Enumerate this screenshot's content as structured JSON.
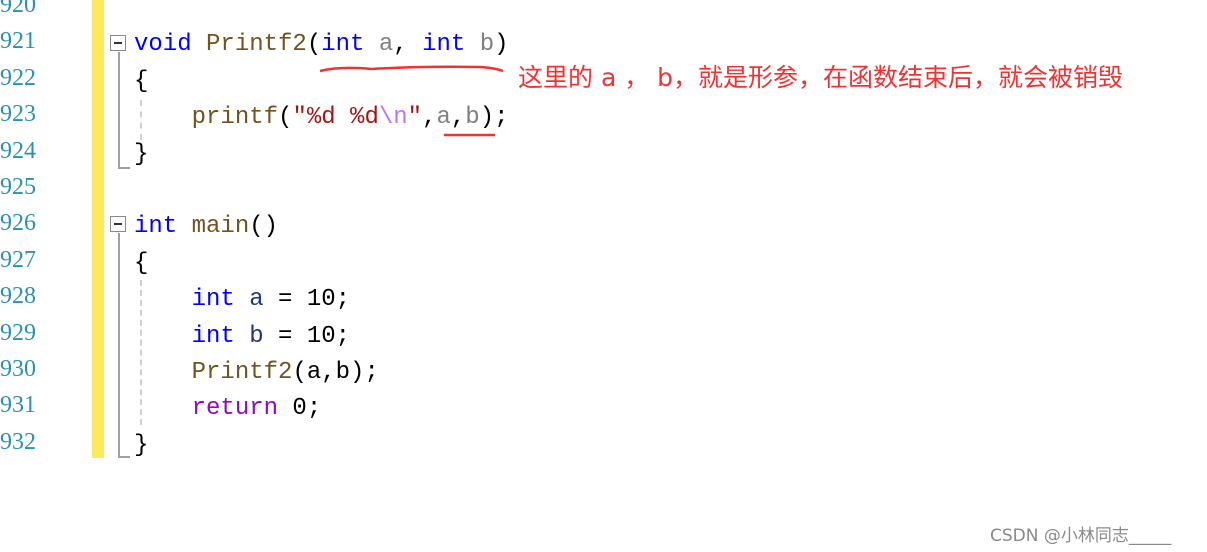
{
  "editor": {
    "line_numbers": [
      "920",
      "921",
      "922",
      "923",
      "924",
      "925",
      "926",
      "927",
      "928",
      "929",
      "930",
      "931",
      "932"
    ],
    "lines": [
      {
        "number": "921",
        "tokens": [
          {
            "t": "void",
            "c": "kw"
          },
          {
            "t": " ",
            "c": "plain"
          },
          {
            "t": "Printf2",
            "c": "fn"
          },
          {
            "t": "(",
            "c": "plain"
          },
          {
            "t": "int",
            "c": "kw"
          },
          {
            "t": " ",
            "c": "plain"
          },
          {
            "t": "a",
            "c": "param"
          },
          {
            "t": ", ",
            "c": "plain"
          },
          {
            "t": "int",
            "c": "kw"
          },
          {
            "t": " ",
            "c": "plain"
          },
          {
            "t": "b",
            "c": "param"
          },
          {
            "t": ")",
            "c": "plain"
          }
        ]
      },
      {
        "number": "922",
        "tokens": [
          {
            "t": "{",
            "c": "plain"
          }
        ]
      },
      {
        "number": "923",
        "tokens": [
          {
            "t": "    ",
            "c": "plain"
          },
          {
            "t": "printf",
            "c": "fn"
          },
          {
            "t": "(",
            "c": "plain"
          },
          {
            "t": "\"%d %d",
            "c": "str"
          },
          {
            "t": "\\n",
            "c": "esc"
          },
          {
            "t": "\"",
            "c": "str"
          },
          {
            "t": ",",
            "c": "plain"
          },
          {
            "t": "a",
            "c": "param"
          },
          {
            "t": ",",
            "c": "plain"
          },
          {
            "t": "b",
            "c": "param"
          },
          {
            "t": ");",
            "c": "plain"
          }
        ]
      },
      {
        "number": "924",
        "tokens": [
          {
            "t": "}",
            "c": "plain"
          }
        ]
      },
      {
        "number": "925",
        "tokens": []
      },
      {
        "number": "926",
        "tokens": [
          {
            "t": "int",
            "c": "kw"
          },
          {
            "t": " ",
            "c": "plain"
          },
          {
            "t": "main",
            "c": "fn"
          },
          {
            "t": "()",
            "c": "plain"
          }
        ]
      },
      {
        "number": "927",
        "tokens": [
          {
            "t": "{",
            "c": "plain"
          }
        ]
      },
      {
        "number": "928",
        "tokens": [
          {
            "t": "    ",
            "c": "plain"
          },
          {
            "t": "int",
            "c": "kw"
          },
          {
            "t": " ",
            "c": "plain"
          },
          {
            "t": "a",
            "c": "local"
          },
          {
            "t": " = 10;",
            "c": "plain"
          }
        ]
      },
      {
        "number": "929",
        "tokens": [
          {
            "t": "    ",
            "c": "plain"
          },
          {
            "t": "int",
            "c": "kw"
          },
          {
            "t": " ",
            "c": "plain"
          },
          {
            "t": "b",
            "c": "local"
          },
          {
            "t": " = 10;",
            "c": "plain"
          }
        ]
      },
      {
        "number": "930",
        "tokens": [
          {
            "t": "    ",
            "c": "plain"
          },
          {
            "t": "Printf2",
            "c": "fn"
          },
          {
            "t": "(a,b);",
            "c": "plain"
          }
        ]
      },
      {
        "number": "931",
        "tokens": [
          {
            "t": "    ",
            "c": "plain"
          },
          {
            "t": "return",
            "c": "ctl"
          },
          {
            "t": " 0;",
            "c": "plain"
          }
        ]
      },
      {
        "number": "932",
        "tokens": [
          {
            "t": "}",
            "c": "plain"
          }
        ]
      }
    ]
  },
  "annotation": {
    "text": "这里的 a ， b，就是形参，在函数结束后，就会被销毁",
    "color": "#f03232"
  },
  "watermark": "CSDN @小林同志_____",
  "colors": {
    "line_number": "#2b91af",
    "change_bar": "#fde95e",
    "keyword": "#0000ff",
    "function": "#74531f"
  }
}
